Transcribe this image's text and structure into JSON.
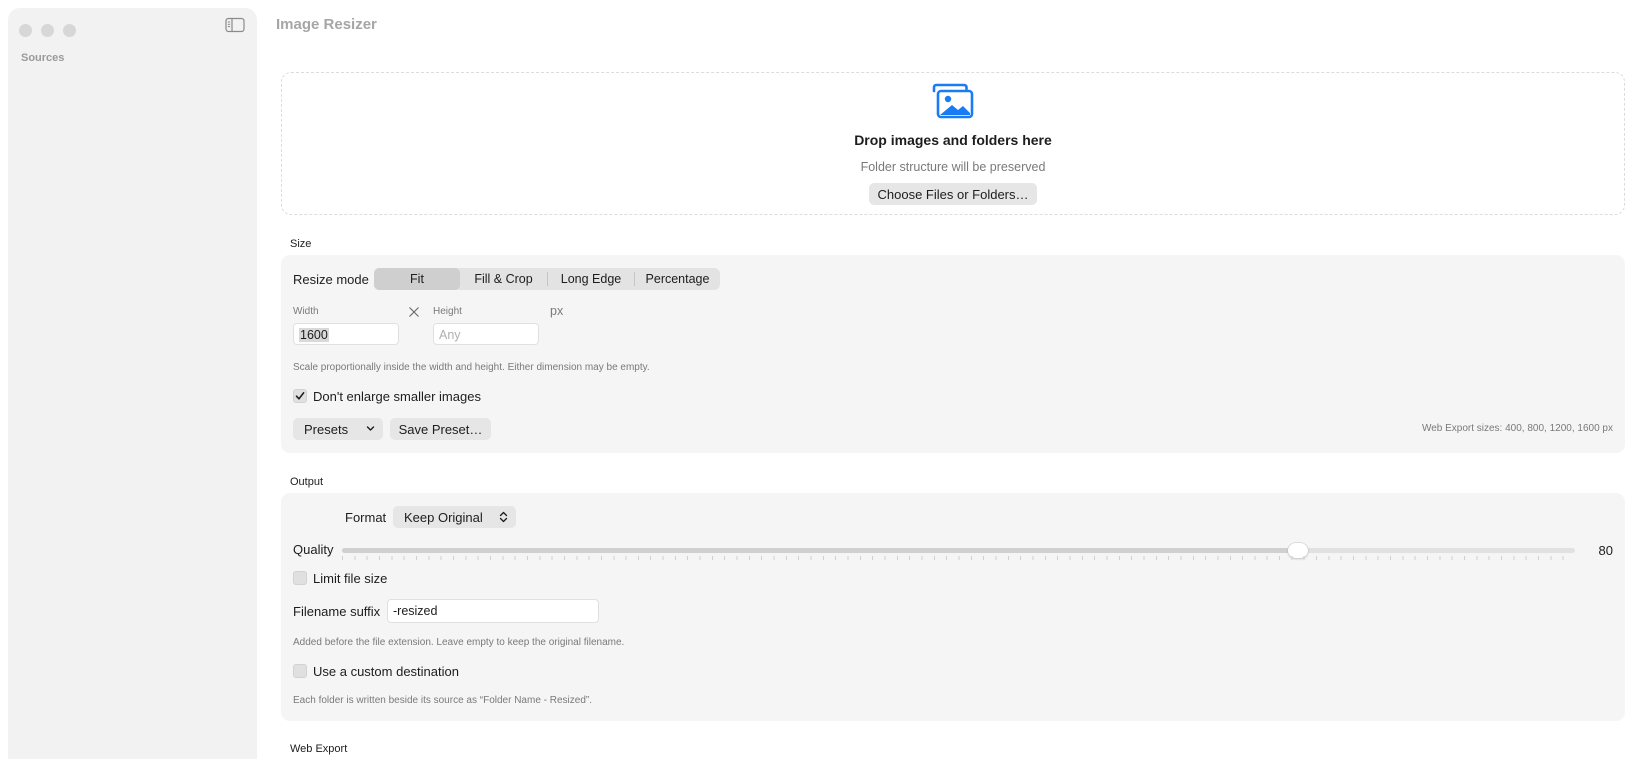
{
  "window": {
    "title": "Image Resizer"
  },
  "sidebar": {
    "section_title": "Sources"
  },
  "dropzone": {
    "title": "Drop images and folders here",
    "subtitle": "Folder structure will be preserved",
    "choose_label": "Choose Files or Folders…"
  },
  "size": {
    "section_label": "Size",
    "resize_mode_label": "Resize mode",
    "modes": [
      "Fit",
      "Fill & Crop",
      "Long Edge",
      "Percentage"
    ],
    "selected_mode": "Fit",
    "width_label": "Width",
    "width_value": "1600",
    "height_label": "Height",
    "height_placeholder": "Any",
    "unit": "px",
    "help": "Scale proportionally inside the width and height. Either dimension may be empty.",
    "dont_enlarge_label": "Don't enlarge smaller images",
    "dont_enlarge_checked": true,
    "presets_label": "Presets",
    "save_preset_label": "Save Preset…",
    "web_export_sizes": "Web Export sizes: 400, 800, 1200, 1600 px"
  },
  "output": {
    "section_label": "Output",
    "format_label": "Format",
    "format_value": "Keep Original",
    "quality_label": "Quality",
    "quality_value": "80",
    "quality_fraction": 0.775,
    "limit_size_label": "Limit file size",
    "limit_size_checked": false,
    "suffix_label": "Filename suffix",
    "suffix_value": "-resized",
    "suffix_help": "Added before the file extension. Leave empty to keep the original filename.",
    "custom_dest_label": "Use a custom destination",
    "custom_dest_checked": false,
    "dest_help": "Each folder is written beside its source as “Folder Name - Resized”."
  },
  "web_export": {
    "section_label": "Web Export"
  },
  "colors": {
    "accent": "#1a7cf5",
    "panel": "#f5f5f5",
    "sidebar": "#f2f2f2"
  },
  "icons": {
    "drop": "photo-stack-icon",
    "sidebar_toggle": "sidebar-toggle-icon",
    "times": "multiply-icon",
    "check": "checkmark-icon",
    "presets_chevron": "chevron-down-icon",
    "format_chevron": "up-down-chevron-icon"
  }
}
